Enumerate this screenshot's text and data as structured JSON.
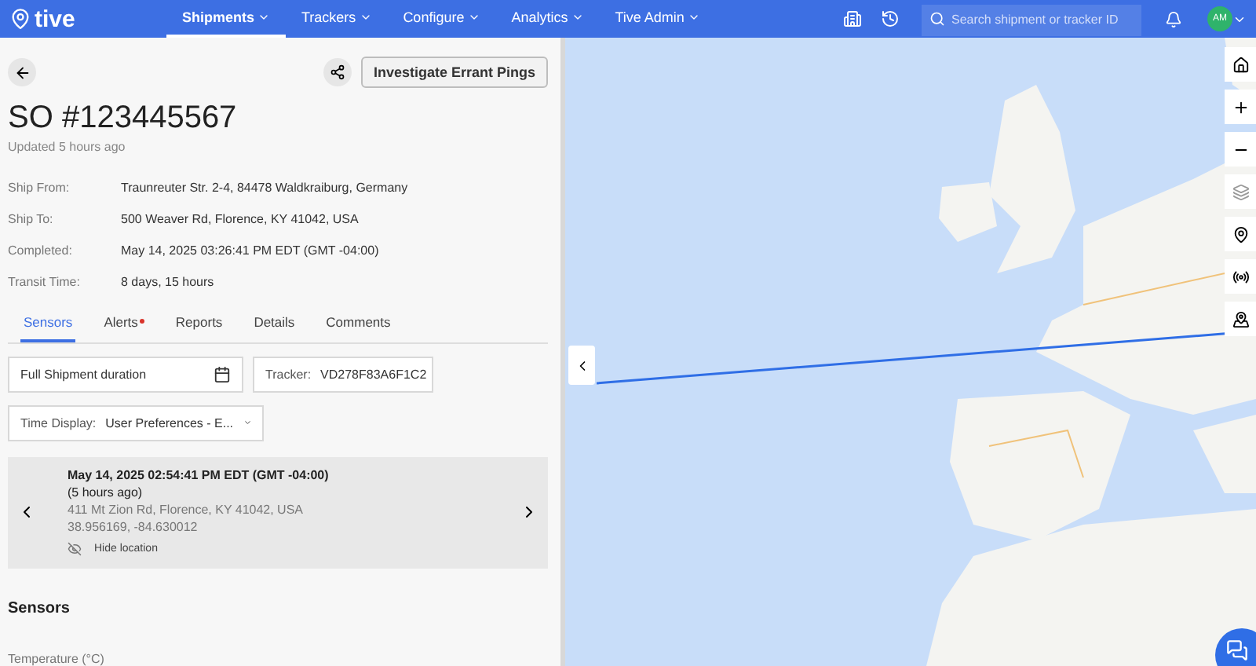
{
  "nav": {
    "logo": "tive",
    "menus": [
      {
        "label": "Shipments",
        "selected": true
      },
      {
        "label": "Trackers",
        "selected": false
      },
      {
        "label": "Configure",
        "selected": false
      },
      {
        "label": "Analytics",
        "selected": false
      },
      {
        "label": "Tive Admin",
        "selected": false
      }
    ],
    "search": {
      "placeholder": "Search shipment or tracker ID"
    },
    "avatar": "AM"
  },
  "header": {
    "action": "Investigate Errant Pings",
    "title": "SO #123445567",
    "updated": "Updated 5 hours ago"
  },
  "details": [
    {
      "label": "Ship From:",
      "value": "Traunreuter Str. 2-4, 84478 Waldkraiburg, Germany"
    },
    {
      "label": "Ship To:",
      "value": "500 Weaver Rd, Florence, KY 41042, USA"
    },
    {
      "label": "Completed:",
      "value": "May 14, 2025 03:26:41 PM EDT (GMT -04:00)"
    },
    {
      "label": "Transit Time:",
      "value": "8 days, 15 hours"
    }
  ],
  "tabs": [
    {
      "label": "Sensors",
      "selected": true,
      "alert": false
    },
    {
      "label": "Alerts",
      "selected": false,
      "alert": true
    },
    {
      "label": "Reports",
      "selected": false,
      "alert": false
    },
    {
      "label": "Details",
      "selected": false,
      "alert": false
    },
    {
      "label": "Comments",
      "selected": false,
      "alert": false
    }
  ],
  "filters": {
    "duration": "Full Shipment duration",
    "tracker_label": "Tracker:",
    "tracker": "VD278F83A6F1C2",
    "time_display_label": "Time Display:",
    "time_display": "User Preferences - E..."
  },
  "location": {
    "time": "May 14, 2025 02:54:41 PM EDT (GMT -04:00)",
    "ago": "(5 hours ago)",
    "address": "411 Mt Zion Rd, Florence, KY 41042, USA",
    "coords": "38.956169, -84.630012",
    "hide": "Hide location"
  },
  "sensors": {
    "title": "Sensors",
    "first": "Temperature (°C)"
  }
}
